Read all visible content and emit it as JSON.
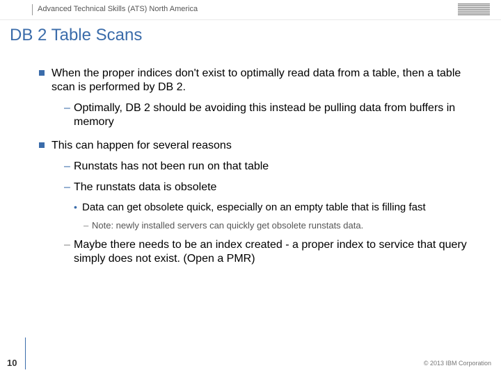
{
  "header": {
    "org": "Advanced Technical Skills (ATS) North America",
    "logo_name": "ibm-logo"
  },
  "title": "DB 2 Table Scans",
  "bullets": {
    "b1": "When the proper indices don't exist to optimally read data from a table, then a table scan is performed by DB 2.",
    "b1_d1": "Optimally, DB 2 should be avoiding this instead be pulling data from buffers in memory",
    "b2": "This can happen for several reasons",
    "b2_d1": "Runstats has not been run on that table",
    "b2_d2": "The runstats data is obsolete",
    "b2_d2_dot": "Data can get obsolete quick, especially on an empty table that is filling fast",
    "b2_d2_note": "Note: newly installed servers can quickly get obsolete runstats data.",
    "b2_d3": "Maybe there needs to be an index created - a proper index to service that query simply does not exist. (Open a PMR)"
  },
  "footer": {
    "page": "10",
    "copyright": "© 2013 IBM Corporation"
  }
}
